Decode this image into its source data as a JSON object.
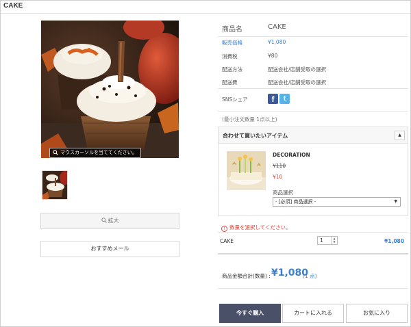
{
  "page": {
    "title": "CAKE"
  },
  "gallery": {
    "hover_hint": "マウスカーソルを当ててください。",
    "zoom_label": "拡大",
    "recommend_label": "おすすめメール"
  },
  "product": {
    "name_label": "商品名",
    "name": "CAKE",
    "price_label": "販売価格",
    "price": "¥1,080",
    "tax_label": "消費税",
    "tax": "¥80",
    "delivery_label": "配送方法",
    "delivery": "配送会社/店舗受取の選択",
    "shipping_label": "配送費",
    "shipping": "配送会社/店舗受取の選択",
    "sns_label": "SNSシェア",
    "min_order": "(最小注文数量 1点以上)"
  },
  "related": {
    "title": "合わせて買いたいアイテム",
    "toggle": "▲",
    "item_name": "DECORATION",
    "old_price": "¥110",
    "new_price": "¥10",
    "select_label": "商品選択",
    "select_value": "- [必須] 商品選択 -"
  },
  "warning": "数量を選択してください。",
  "order": {
    "item": "CAKE",
    "quantity": "1",
    "price": "¥1,080",
    "total_label": "商品金額合計(数量) :",
    "total": "¥1,080",
    "total_count": "(1 点)"
  },
  "actions": {
    "buy": "今すぐ購入",
    "cart": "カートに入れる",
    "favorite": "お気に入り"
  },
  "colors": {
    "accent_blue": "#3a7fd0",
    "warning_red": "#e0463a",
    "buy_button": "#4a5068"
  }
}
